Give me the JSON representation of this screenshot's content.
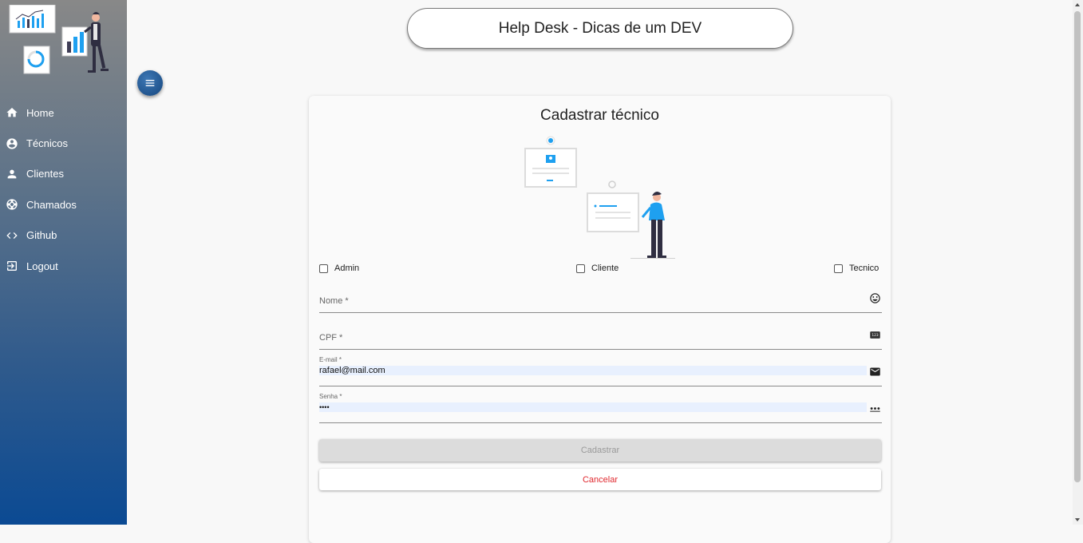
{
  "app": {
    "title": "Help Desk - Dicas de um DEV"
  },
  "sidebar": {
    "items": [
      {
        "label": "Home",
        "icon": "home-icon"
      },
      {
        "label": "Técnicos",
        "icon": "account-circle-icon"
      },
      {
        "label": "Clientes",
        "icon": "person-icon"
      },
      {
        "label": "Chamados",
        "icon": "support-icon"
      },
      {
        "label": "Github",
        "icon": "code-icon"
      },
      {
        "label": "Logout",
        "icon": "logout-icon"
      }
    ]
  },
  "form": {
    "title": "Cadastrar técnico",
    "profiles": [
      {
        "label": "Admin",
        "checked": false
      },
      {
        "label": "Cliente",
        "checked": false
      },
      {
        "label": "Tecnico",
        "checked": false
      }
    ],
    "fields": {
      "nome": {
        "label": "Nome *",
        "value": "",
        "icon": "smiley-icon"
      },
      "cpf": {
        "label": "CPF *",
        "value": "",
        "icon": "pin-123-icon"
      },
      "email": {
        "label": "E-mail *",
        "value": "rafael@mail.com",
        "icon": "mail-icon"
      },
      "senha": {
        "label": "Senha *",
        "value": "••••",
        "icon": "password-dots-icon"
      }
    },
    "submit_label": "Cadastrar",
    "cancel_label": "Cancelar"
  },
  "colors": {
    "sidebar_top": "#888888",
    "sidebar_bottom": "#0b4a93",
    "accent_blue": "#1ea0f0",
    "cancel_red": "#e0282e"
  }
}
